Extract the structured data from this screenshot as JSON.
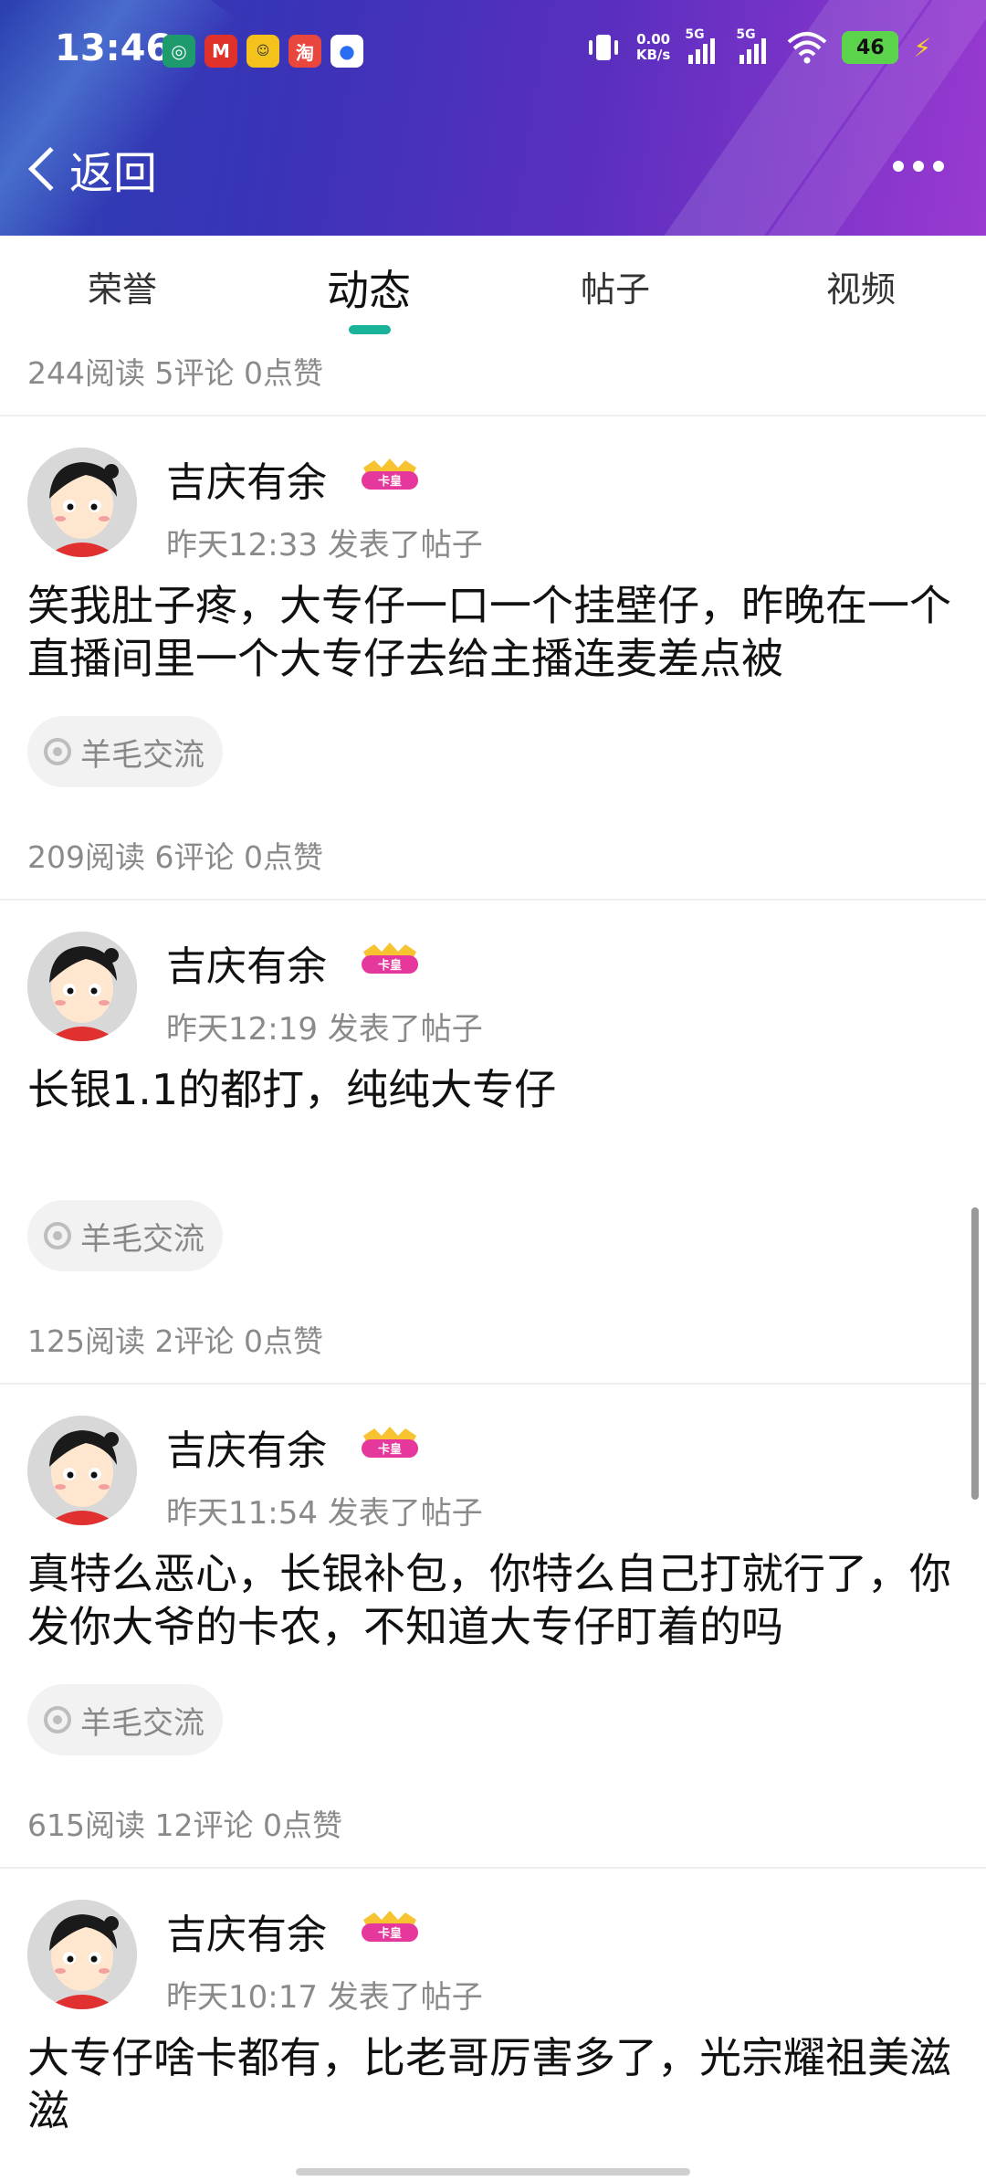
{
  "status_bar": {
    "time": "13:46",
    "net_speed_value": "0.00",
    "net_speed_unit": "KB/s",
    "sim1_label": "5G",
    "sim2_label": "5G",
    "battery_level": "46",
    "notification_icons": [
      "bank-icon",
      "metro-icon",
      "meituan-icon",
      "taobao-icon",
      "browser-icon"
    ]
  },
  "navbar": {
    "back_label": "返回"
  },
  "tabs": [
    {
      "label": "荣誉",
      "active": false
    },
    {
      "label": "动态",
      "active": true
    },
    {
      "label": "帖子",
      "active": false
    },
    {
      "label": "视频",
      "active": false
    }
  ],
  "top_stats": "244阅读 5评论 0点赞",
  "posts": [
    {
      "username": "吉庆有余",
      "badge": "卡皇",
      "meta": "昨天12:33  发表了帖子",
      "text": "笑我肚子疼，大专仔一口一个挂壁仔，昨晚在一个直播间里一个大专仔去给主播连麦差点被",
      "tag": "羊毛交流",
      "stats": "209阅读 6评论 0点赞"
    },
    {
      "username": "吉庆有余",
      "badge": "卡皇",
      "meta": "昨天12:19  发表了帖子",
      "text": "长银1.1的都打，纯纯大专仔",
      "tag": "羊毛交流",
      "stats": "125阅读 2评论 0点赞"
    },
    {
      "username": "吉庆有余",
      "badge": "卡皇",
      "meta": "昨天11:54  发表了帖子",
      "text": "真特么恶心，长银补包，你特么自己打就行了，你发你大爷的卡农，不知道大专仔盯着的吗",
      "tag": "羊毛交流",
      "stats": "615阅读 12评论 0点赞"
    },
    {
      "username": "吉庆有余",
      "badge": "卡皇",
      "meta": "昨天10:17  发表了帖子",
      "text": "大专仔啥卡都有，比老哥厉害多了，光宗耀祖美滋滋"
    }
  ],
  "colors": {
    "accent": "#19b39a",
    "header_gradient_start": "#2b3fb0",
    "header_gradient_end": "#9a3ad0",
    "badge_pink": "#e5379c",
    "battery_green": "#5bd34b"
  }
}
